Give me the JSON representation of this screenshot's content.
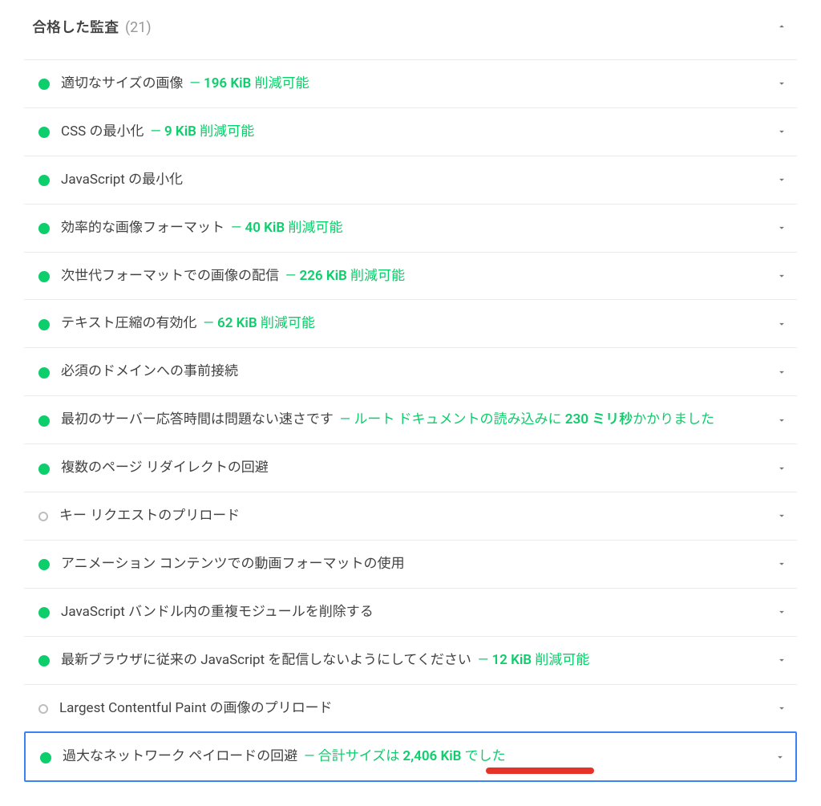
{
  "header": {
    "title": "合格した監査",
    "count": "(21)"
  },
  "audits": [
    {
      "marker": "pass",
      "label": "適切なサイズの画像",
      "detail_prefix": "— ",
      "detail_bold": "196 KiB",
      "detail_suffix": " 削減可能"
    },
    {
      "marker": "pass",
      "label": "CSS の最小化",
      "detail_prefix": "— ",
      "detail_bold": "9 KiB",
      "detail_suffix": " 削減可能"
    },
    {
      "marker": "pass",
      "label": "JavaScript の最小化",
      "detail_prefix": "",
      "detail_bold": "",
      "detail_suffix": ""
    },
    {
      "marker": "pass",
      "label": "効率的な画像フォーマット",
      "detail_prefix": "— ",
      "detail_bold": "40 KiB",
      "detail_suffix": " 削減可能"
    },
    {
      "marker": "pass",
      "label": "次世代フォーマットでの画像の配信",
      "detail_prefix": "— ",
      "detail_bold": "226 KiB",
      "detail_suffix": " 削減可能"
    },
    {
      "marker": "pass",
      "label": "テキスト圧縮の有効化",
      "detail_prefix": "— ",
      "detail_bold": "62 KiB",
      "detail_suffix": " 削減可能"
    },
    {
      "marker": "pass",
      "label": "必須のドメインへの事前接続",
      "detail_prefix": "",
      "detail_bold": "",
      "detail_suffix": ""
    },
    {
      "marker": "pass",
      "label": "最初のサーバー応答時間は問題ない速さです",
      "detail_prefix": "— ルート ドキュメントの読み込みに ",
      "detail_bold": "230 ミリ秒",
      "detail_suffix": "かかりました",
      "multiline": true
    },
    {
      "marker": "pass",
      "label": "複数のページ リダイレクトの回避",
      "detail_prefix": "",
      "detail_bold": "",
      "detail_suffix": ""
    },
    {
      "marker": "neutral",
      "label": "キー リクエストのプリロード",
      "detail_prefix": "",
      "detail_bold": "",
      "detail_suffix": ""
    },
    {
      "marker": "pass",
      "label": "アニメーション コンテンツでの動画フォーマットの使用",
      "detail_prefix": "",
      "detail_bold": "",
      "detail_suffix": ""
    },
    {
      "marker": "pass",
      "label": "JavaScript バンドル内の重複モジュールを削除する",
      "detail_prefix": "",
      "detail_bold": "",
      "detail_suffix": ""
    },
    {
      "marker": "pass",
      "label": "最新ブラウザに従来の JavaScript を配信しないようにしてください",
      "detail_prefix": "— ",
      "detail_bold": "12 KiB",
      "detail_suffix": " 削減可能"
    },
    {
      "marker": "neutral",
      "label": "Largest Contentful Paint の画像のプリロード",
      "detail_prefix": "",
      "detail_bold": "",
      "detail_suffix": ""
    },
    {
      "marker": "pass",
      "label": "過大なネットワーク ペイロードの回避",
      "detail_prefix": "— 合計サイズは ",
      "detail_bold": "2,406 KiB",
      "detail_suffix": " でした",
      "selected": true,
      "underline": true
    }
  ]
}
